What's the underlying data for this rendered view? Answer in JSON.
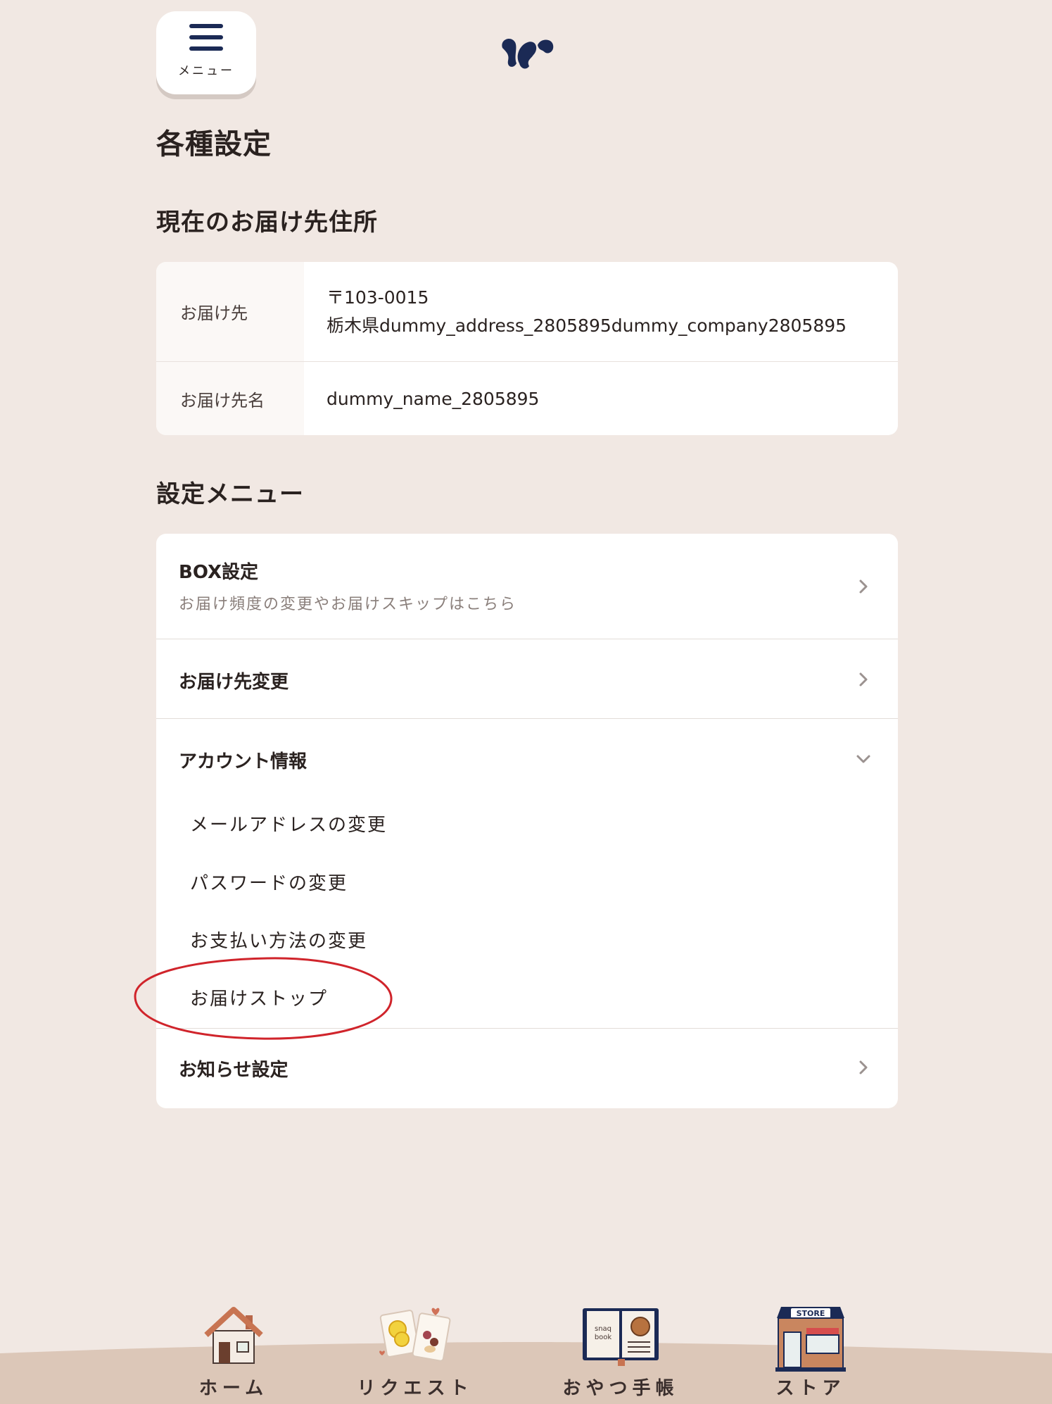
{
  "header": {
    "menu_label": "メニュー",
    "logo": "squirrel-logo"
  },
  "page_title": "各種設定",
  "address_section": {
    "heading": "現在のお届け先住所",
    "rows": [
      {
        "label": "お届け先",
        "lines": [
          "〒103-0015",
          "栃木県dummy_address_2805895dummy_company2805895"
        ]
      },
      {
        "label": "お届け先名",
        "lines": [
          "dummy_name_2805895"
        ]
      }
    ]
  },
  "settings_section": {
    "heading": "設定メニュー",
    "items": [
      {
        "title": "BOX設定",
        "subtitle": "お届け頻度の変更やお届けスキップはこちら",
        "icon": "chevron-right-icon"
      },
      {
        "title": "お届け先変更",
        "icon": "chevron-right-icon"
      },
      {
        "title": "アカウント情報",
        "icon": "chevron-down-icon",
        "expanded": true,
        "children": [
          "メールアドレスの変更",
          "パスワードの変更",
          "お支払い方法の変更",
          "お届けストップ"
        ]
      },
      {
        "title": "お知らせ設定",
        "icon": "chevron-right-icon"
      }
    ]
  },
  "annotation": {
    "shape": "ellipse",
    "color": "#d0242b",
    "target": "お届けストップ"
  },
  "tabbar": {
    "tabs": [
      {
        "label": "ホーム",
        "icon": "house-icon"
      },
      {
        "label": "リクエスト",
        "icon": "request-snacks-icon"
      },
      {
        "label": "おやつ手帳",
        "icon": "snaq-book-icon",
        "icon_text": [
          "snaq",
          "book"
        ]
      },
      {
        "label": "ストア",
        "icon": "store-icon",
        "icon_text": "STORE"
      }
    ]
  },
  "colors": {
    "background": "#f1e8e3",
    "card": "#ffffff",
    "brand_navy": "#1b2a55",
    "annotation_red": "#d0242b",
    "tabbar": "#dcc7b8"
  }
}
